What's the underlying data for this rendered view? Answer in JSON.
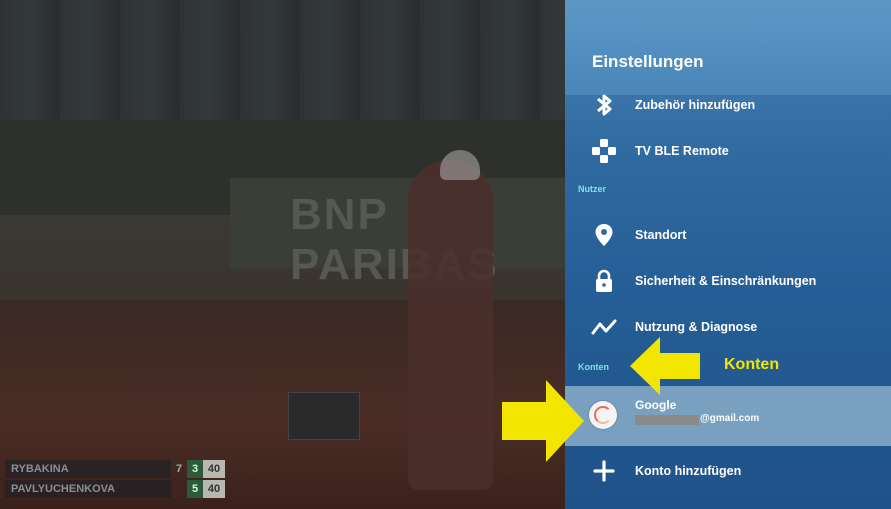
{
  "panel": {
    "title": "Einstellungen",
    "items": [
      {
        "label": "Zubehör hinzufügen",
        "icon": "bluetooth-icon"
      },
      {
        "label": "TV BLE Remote",
        "icon": "gamepad-icon"
      }
    ],
    "section_user": "Nutzer",
    "user_items": [
      {
        "label": "Standort",
        "icon": "location-pin-icon"
      },
      {
        "label": "Sicherheit & Einschränkungen",
        "icon": "lock-icon"
      },
      {
        "label": "Nutzung & Diagnose",
        "icon": "activity-icon"
      }
    ],
    "section_accounts": "Konten",
    "account": {
      "name": "Google",
      "email_suffix": "@gmail.com"
    },
    "add_account": "Konto hinzufügen"
  },
  "annotation": {
    "label": "Konten",
    "color": "#f2e500"
  },
  "scoreboard": {
    "rows": [
      {
        "name": "RYBAKINA",
        "sets": "7",
        "games": "3",
        "points": "40"
      },
      {
        "name": "PAVLYUCHENKOVA",
        "sets": "",
        "games": "5",
        "points": "40"
      }
    ]
  },
  "background_banner": "BNP PARIBAS",
  "colors": {
    "panel_accent": "#2f6aa0",
    "section_header": "#7fe0e8",
    "selected_row": "#7aa0c0"
  }
}
